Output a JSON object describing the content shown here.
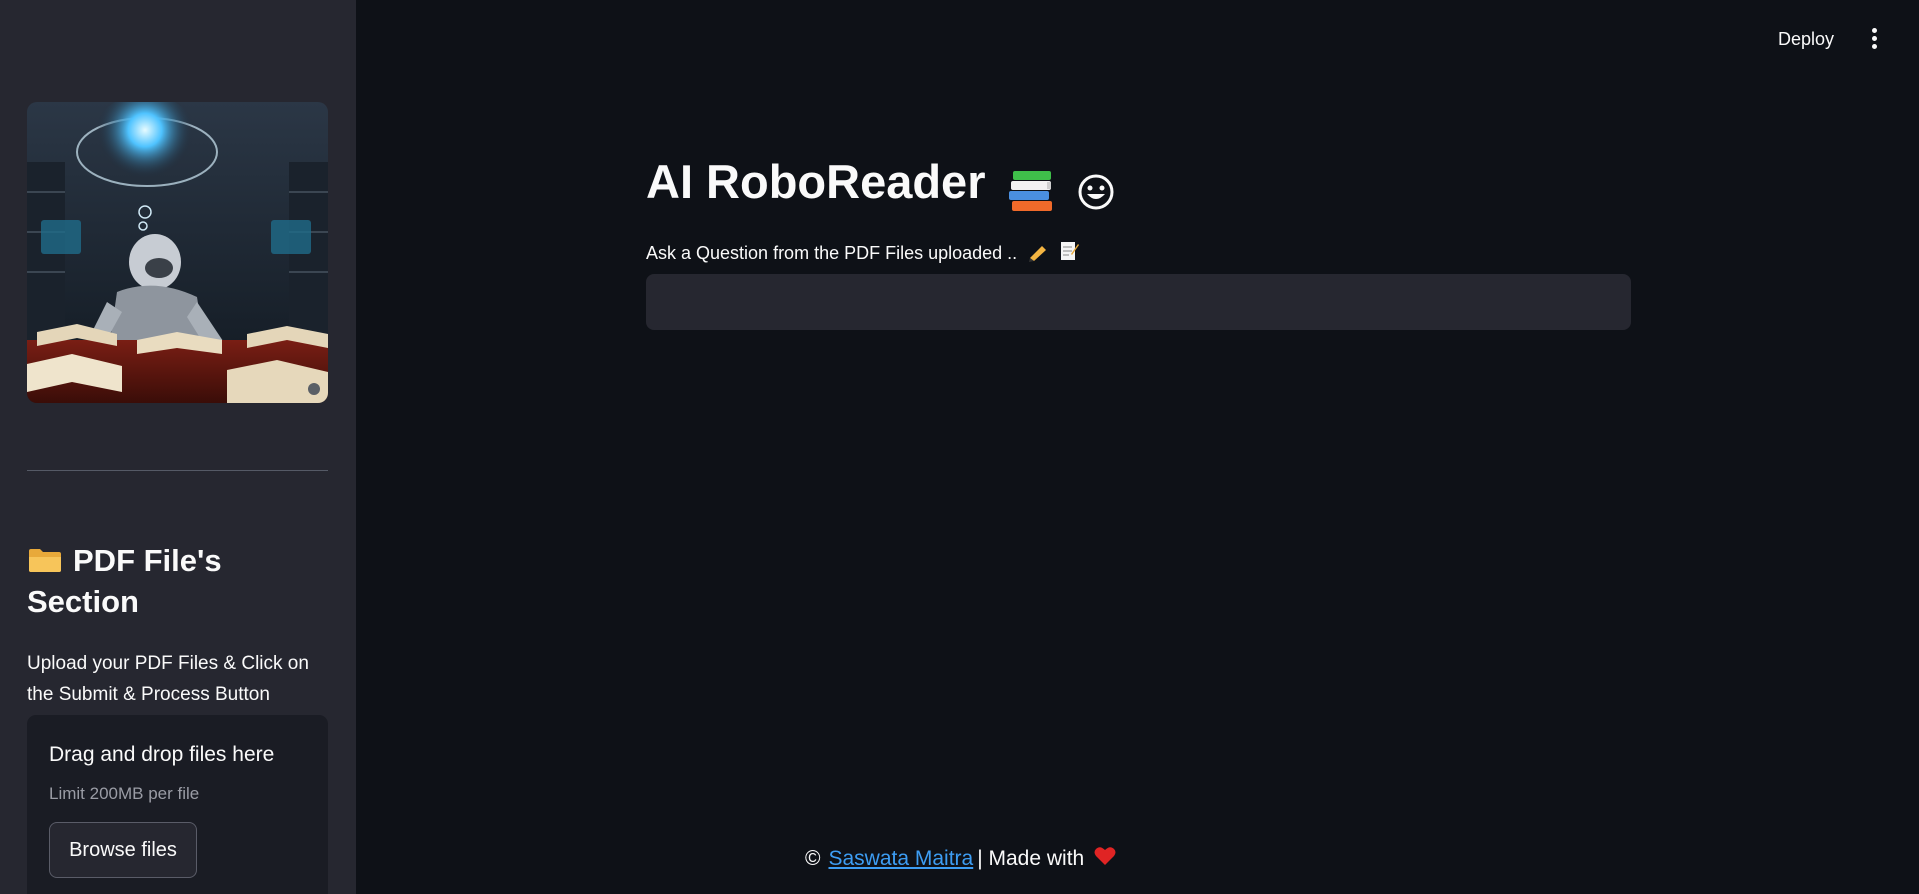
{
  "header": {
    "deploy_label": "Deploy",
    "menu_icon": "more-vertical-icon"
  },
  "sidebar": {
    "image_icon": "robot-reading-books-image",
    "section_title": "PDF File's Section",
    "section_icon": "folder-icon",
    "description": "Upload your PDF Files & Click on the Submit & Process Button",
    "uploader": {
      "title": "Drag and drop files here",
      "limit": "Limit 200MB per file",
      "browse_label": "Browse files"
    }
  },
  "main": {
    "title": "AI RoboReader",
    "title_icons": [
      "books-icon",
      "grinning-face-icon"
    ],
    "question_label": "Ask a Question from the PDF Files uploaded ..",
    "question_label_icons": [
      "writing-hand-icon",
      "memo-icon"
    ],
    "question_value": ""
  },
  "footer": {
    "prefix": "©",
    "author": "Saswata Maitra",
    "suffix": "| Made with",
    "heart_icon": "heart-icon"
  },
  "colors": {
    "background": "#0e1117",
    "sidebar": "#262730",
    "link": "#3d9df3",
    "heart": "#e02424"
  }
}
